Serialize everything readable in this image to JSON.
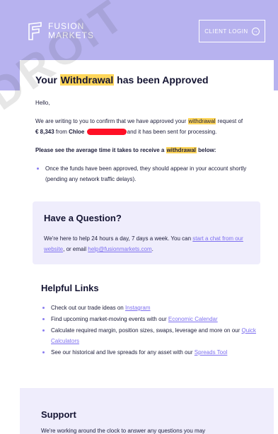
{
  "header": {
    "logo_line1": "FUSION",
    "logo_line2": "MARKETS",
    "login_label": "CLIENT LOGIN",
    "watermark": "DROIT"
  },
  "email": {
    "title_pre": "Your ",
    "title_hl": "Withdrawal",
    "title_post": " has been Approved",
    "greeting": "Hello,",
    "p1_pre": "We are writing to you to confirm that we have approved your ",
    "p1_hl": "withdrawal",
    "p1_post": " request of",
    "amount": "€ 8,343",
    "from": " from ",
    "name": "Chloe",
    "p1_tail": "and it has been sent for processing.",
    "p2_pre": "Please see the average time it takes to receive a ",
    "p2_hl": "withdrawal",
    "p2_post": " below:",
    "bullet1": "Once the funds have been approved, they should appear in your account shortly (pending any network traffic delays)."
  },
  "question": {
    "title": "Have a Question?",
    "text_pre": "We're here to help 24 hours a day, 7 days a week. You can ",
    "chat_link": "start a chat from our website",
    "text_mid": ", or email ",
    "email_link": "help@fusionmarkets.com",
    "text_post": "."
  },
  "helpful": {
    "title": "Helpful Links",
    "items": [
      {
        "pre": "Check out our trade ideas on ",
        "link": "Instagram",
        "post": ""
      },
      {
        "pre": "Find upcoming market-moving events with our ",
        "link": "Economic Calendar",
        "post": ""
      },
      {
        "pre": "Calculate required margin, position sizes, swaps, leverage and more on our ",
        "link": "Quick Calculators",
        "post": ""
      },
      {
        "pre": "See our historical and live spreads for any asset with our ",
        "link": "Spreads Tool",
        "post": ""
      }
    ]
  },
  "support": {
    "title": "Support",
    "text": "We're working around the clock to answer any questions you may"
  },
  "colors": {
    "hero": "#b7b2ef",
    "highlight": "#ffd65a",
    "link": "#7d6ff0",
    "panel": "#efedfc",
    "redaction": "#ff1026"
  }
}
